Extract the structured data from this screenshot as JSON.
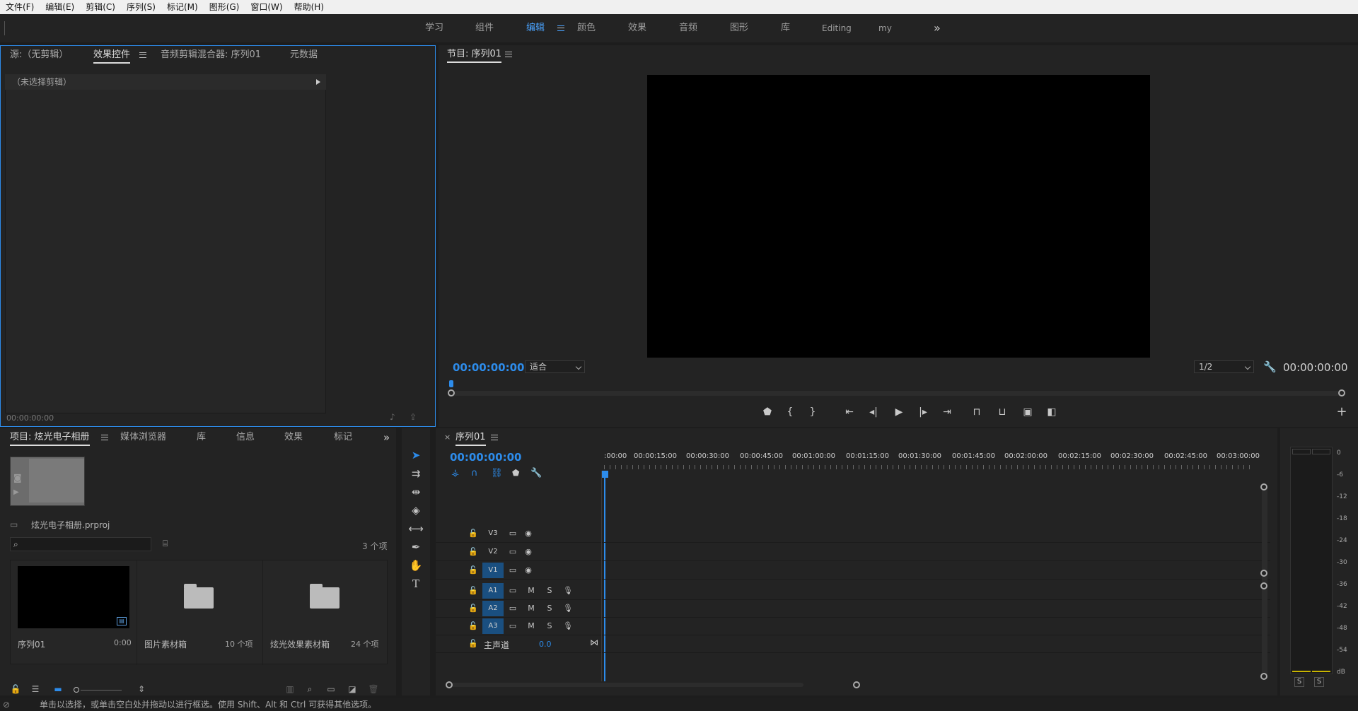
{
  "menu": [
    "文件(F)",
    "编辑(E)",
    "剪辑(C)",
    "序列(S)",
    "标记(M)",
    "图形(G)",
    "窗口(W)",
    "帮助(H)"
  ],
  "workspaces": {
    "items": [
      "学习",
      "组件",
      "编辑",
      "颜色",
      "效果",
      "音频",
      "图形",
      "库",
      "Editing",
      "my"
    ],
    "active": "编辑",
    "overflow": "»"
  },
  "effects_panel": {
    "tabs": [
      "源:（无剪辑）",
      "效果控件",
      "音频剪辑混合器: 序列01",
      "元数据"
    ],
    "active_tab": "效果控件",
    "no_clip_text": "（未选择剪辑）",
    "timecode": "00:00:00:00"
  },
  "program": {
    "title": "节目: 序列01",
    "timecode_left": "00:00:00:00",
    "zoom": "适合",
    "resolution": "1/2",
    "timecode_right": "00:00:00:00"
  },
  "project": {
    "tabs": [
      "项目: 炫光电子相册",
      "媒体浏览器",
      "库",
      "信息",
      "效果",
      "标记"
    ],
    "active_tab": "项目: 炫光电子相册",
    "file_name": "炫光电子相册.prproj",
    "item_count": "3 个项",
    "items": [
      {
        "name": "序列01",
        "meta": "0:00",
        "type": "sequence"
      },
      {
        "name": "图片素材箱",
        "meta": "10 个项",
        "type": "bin"
      },
      {
        "name": "炫光效果素材箱",
        "meta": "24 个项",
        "type": "bin"
      }
    ]
  },
  "timeline": {
    "title": "序列01",
    "timecode": "00:00:00:00",
    "ruler": [
      ":00:00",
      "00:00:15:00",
      "00:00:30:00",
      "00:00:45:00",
      "00:01:00:00",
      "00:01:15:00",
      "00:01:30:00",
      "00:01:45:00",
      "00:02:00:00",
      "00:02:15:00",
      "00:02:30:00",
      "00:02:45:00",
      "00:03:00:00"
    ],
    "video_tracks": [
      "V3",
      "V2",
      "V1"
    ],
    "audio_tracks": [
      "A1",
      "A2",
      "A3"
    ],
    "master_label": "主声道",
    "master_value": "0.0",
    "mute_label": "M",
    "solo_label": "S"
  },
  "meter": {
    "scale": [
      "0",
      "-6",
      "-12",
      "-18",
      "-24",
      "-30",
      "-36",
      "-42",
      "-48",
      "-54",
      "dB"
    ],
    "solo_labels": [
      "S",
      "S"
    ]
  },
  "status_text": "单击以选择，或单击空白处并拖动以进行框选。使用 Shift、Alt 和 Ctrl 可获得其他选项。",
  "colors": {
    "accent": "#2d8ceb",
    "panel_bg": "#232323",
    "track_on": "#1a4f80"
  }
}
